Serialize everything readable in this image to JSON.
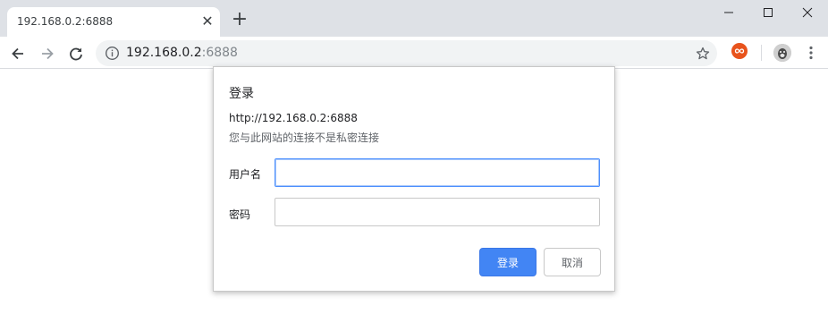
{
  "tab": {
    "title": "192.168.0.2:6888",
    "close_glyph": "✕"
  },
  "new_tab_glyph": "+",
  "address_bar": {
    "host": "192.168.0.2",
    "port": ":6888"
  },
  "dialog": {
    "title": "登录",
    "url": "http://192.168.0.2:6888",
    "warning": "您与此网站的连接不是私密连接",
    "username_label": "用户名",
    "username_value": "",
    "password_label": "密码",
    "password_value": "",
    "login_button": "登录",
    "cancel_button": "取消"
  },
  "colors": {
    "accent": "#4285f4",
    "tabstrip_bg": "#dee1e6",
    "omnibox_bg": "#f1f3f4",
    "extension_orange": "#e8531c"
  },
  "icons": [
    "back-icon",
    "forward-icon",
    "reload-icon",
    "info-icon",
    "star-icon",
    "extension-icon",
    "avatar-icon",
    "menu-icon",
    "minimize-icon",
    "maximize-icon",
    "close-window-icon"
  ]
}
